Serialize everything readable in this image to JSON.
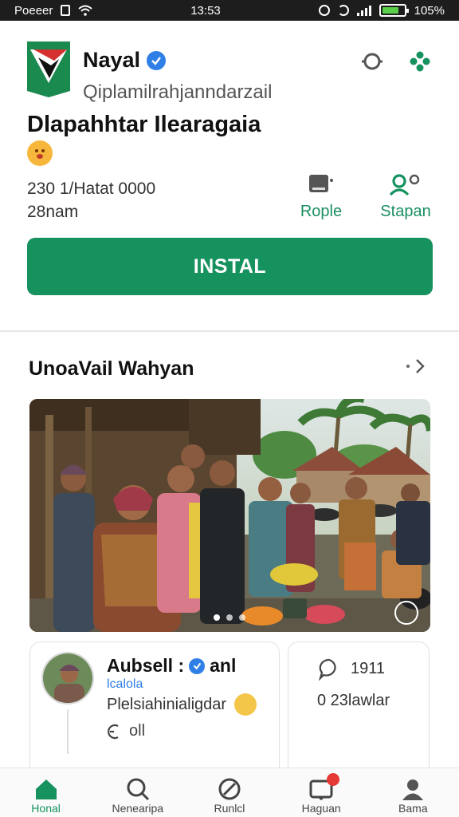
{
  "status_bar": {
    "carrier": "Poeeer",
    "time": "13:53",
    "battery": "105%",
    "battery_fill": 0.8
  },
  "app": {
    "name": "Nayal",
    "handle": "Qiplamilrahjanndarzail",
    "title": "Dlapahhtar Ilearagaia",
    "stats_line1": "230 1/Hatat 0000",
    "stats_line2": "28nam",
    "icon": "flag-app-icon"
  },
  "actions": {
    "people_label": "Rople",
    "stapan_label": "Stapan"
  },
  "install_label": "INSTAL",
  "section": {
    "title": "UnoaVail Wahyan"
  },
  "carousel": {
    "total_dots": 3,
    "active_dot": 0
  },
  "comment": {
    "author": "Aubsell : ",
    "author_suffix": "anl",
    "tag": "lcalola",
    "text": "Plelsiahinialigdar",
    "reply_label": "oll"
  },
  "side_card": {
    "count1": "1911",
    "count2": "0 23lawlar"
  },
  "bottom_nav": [
    {
      "label": "Honal",
      "icon": "home-icon",
      "active": true
    },
    {
      "label": "Nenearipa",
      "icon": "search-icon",
      "active": false
    },
    {
      "label": "Runlcl",
      "icon": "compass-icon",
      "active": false
    },
    {
      "label": "Haguan",
      "icon": "inbox-icon",
      "active": false
    },
    {
      "label": "Bama",
      "icon": "profile-icon",
      "active": false
    }
  ],
  "colors": {
    "accent": "#16925f",
    "verified": "#2f7fe6",
    "badge": "#e53935"
  }
}
